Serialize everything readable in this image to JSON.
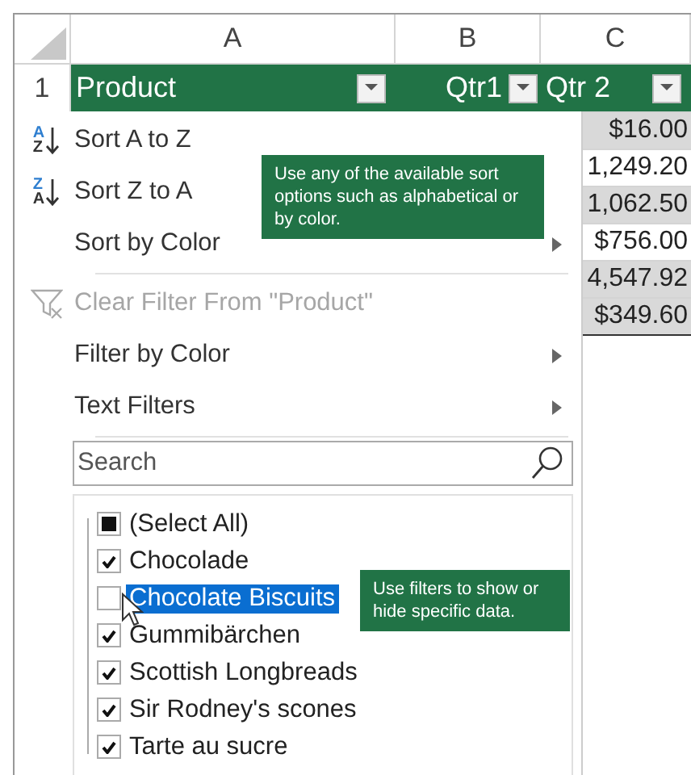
{
  "columns": [
    {
      "label": "A"
    },
    {
      "label": "B"
    },
    {
      "label": "C"
    }
  ],
  "header_row": {
    "number": "1",
    "cells": [
      {
        "label": "Product",
        "filter": true
      },
      {
        "label": "Qtr1",
        "filter": true
      },
      {
        "label": "Qtr 2",
        "filter": true
      }
    ]
  },
  "column_c_cells": [
    {
      "value": "$16.00",
      "shaded": true
    },
    {
      "value": "1,249.20",
      "shaded": false
    },
    {
      "value": "1,062.50",
      "shaded": true
    },
    {
      "value": "$756.00",
      "shaded": false
    },
    {
      "value": "4,547.92",
      "shaded": true
    },
    {
      "value": "$349.60",
      "shaded": true
    }
  ],
  "menu": {
    "items": [
      {
        "kind": "sort",
        "icon_letters": [
          "A",
          "Z"
        ],
        "label": "Sort A to Z",
        "disabled": false,
        "submenu": false
      },
      {
        "kind": "sort",
        "icon_letters": [
          "Z",
          "A"
        ],
        "label": "Sort Z to A",
        "disabled": false,
        "submenu": false
      },
      {
        "kind": "item",
        "label": "Sort by Color",
        "disabled": false,
        "submenu": true
      },
      {
        "kind": "separator"
      },
      {
        "kind": "clear-filter",
        "label": "Clear Filter From \"Product\"",
        "disabled": true,
        "submenu": false
      },
      {
        "kind": "item",
        "label": "Filter by Color",
        "disabled": false,
        "submenu": true
      },
      {
        "kind": "item",
        "label": "Text Filters",
        "disabled": false,
        "submenu": true
      },
      {
        "kind": "separator"
      }
    ],
    "search": {
      "placeholder": "Search"
    },
    "values": [
      {
        "label": "(Select All)",
        "checked": false,
        "partial": true,
        "selected": false
      },
      {
        "label": "Chocolade",
        "checked": true,
        "selected": false
      },
      {
        "label": "Chocolate Biscuits",
        "checked": false,
        "selected": true
      },
      {
        "label": "Gummibärchen",
        "checked": true,
        "selected": false
      },
      {
        "label": "Scottish Longbreads",
        "checked": true,
        "selected": false
      },
      {
        "label": "Sir Rodney's scones",
        "checked": true,
        "selected": false
      },
      {
        "label": "Tarte au sucre",
        "checked": true,
        "selected": false
      }
    ]
  },
  "callouts": [
    {
      "kind": "sort",
      "text": "Use any of the available sort options such as alphabetical or by color."
    },
    {
      "kind": "filter",
      "text": "Use filters to show or hide specific data."
    }
  ]
}
